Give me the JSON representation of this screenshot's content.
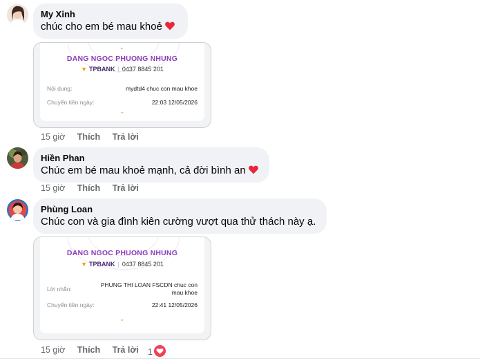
{
  "comments": [
    {
      "author": "My Xinh",
      "text": "chúc cho em bé mau khoẻ",
      "time": "15 giờ",
      "like": "Thích",
      "reply": "Trả lời"
    },
    {
      "author": "Hiền Phan",
      "text": "Chúc em bé mau khoẻ mạnh, cả đời bình an",
      "time": "15 giờ",
      "like": "Thích",
      "reply": "Trả lời"
    },
    {
      "author": "Phùng Loan",
      "text": "Chúc con và gia đình kiên cường vượt qua thử thách này ạ.",
      "time": "15 giờ",
      "like": "Thích",
      "reply": "Trả lời",
      "reaction_count": "1"
    }
  ],
  "receipts": [
    {
      "name": "DANG NGOC PHUONG NHUNG",
      "bank": "TPBANK",
      "account": "0437 8845 201",
      "label1": "Nội dung:",
      "value1": "mydtd4 chuc con mau khoe",
      "label2": "Chuyển tiền ngày:",
      "value2": "22:03 12/05/2026"
    },
    {
      "name": "DANG NGOC PHUONG NHUNG",
      "bank": "TPBANK",
      "account": "0437 8845 201",
      "label1": "Lời nhắn:",
      "value1_line1": "PHUNG THI LOAN FSCDN chuc con",
      "value1_line2": "mau khoe",
      "label2": "Chuyển tiền ngày:",
      "value2": "22:41 12/05/2026"
    }
  ],
  "colors": {
    "bubble": "#f0f2f5",
    "meta": "#65676b",
    "receipt_name": "#8a3bb8",
    "heart": "#f33e58"
  },
  "icons": [
    "heart-icon",
    "chevron-down-icon",
    "tpbank-logo-icon",
    "heart-reaction-icon"
  ]
}
